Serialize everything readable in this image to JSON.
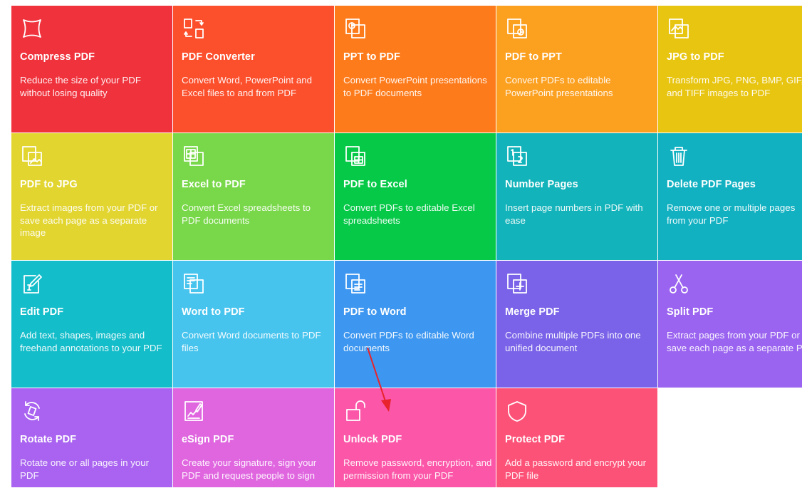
{
  "tools": [
    {
      "title": "Compress PDF",
      "description": "Reduce the size of your PDF without losing quality",
      "color": "#f0323c",
      "icon": "compress-icon"
    },
    {
      "title": "PDF Converter",
      "description": "Convert Word, PowerPoint and Excel files to and from PDF",
      "color": "#fc4f2c",
      "icon": "convert-icon"
    },
    {
      "title": "PPT to PDF",
      "description": "Convert PowerPoint presentations to PDF documents",
      "color": "#fd7b1b",
      "icon": "ppt-icon"
    },
    {
      "title": "PDF to PPT",
      "description": "Convert PDFs to editable PowerPoint presentations",
      "color": "#fca020",
      "icon": "pdf-to-ppt-icon"
    },
    {
      "title": "JPG to PDF",
      "description": "Transform JPG, PNG, BMP, GIF, and TIFF images to PDF",
      "color": "#e8c511",
      "icon": "image-icon"
    },
    {
      "title": "PDF to JPG",
      "description": "Extract images from your PDF or save each page as a separate image",
      "color": "#e2d530",
      "icon": "pdf-to-image-icon"
    },
    {
      "title": "Excel to PDF",
      "description": "Convert Excel spreadsheets to PDF documents",
      "color": "#79d84a",
      "icon": "spreadsheet-icon"
    },
    {
      "title": "PDF to Excel",
      "description": "Convert PDFs to editable Excel spreadsheets",
      "color": "#05c947",
      "icon": "pdf-to-excel-icon"
    },
    {
      "title": "Number Pages",
      "description": "Insert page numbers in PDF with ease",
      "color": "#12b3ba",
      "icon": "number-pages-icon"
    },
    {
      "title": "Delete PDF Pages",
      "description": "Remove one or multiple pages from your PDF",
      "color": "#12b1c2",
      "icon": "trash-icon"
    },
    {
      "title": "Edit PDF",
      "description": "Add text, shapes, images and freehand annotations to your PDF",
      "color": "#14bdca",
      "icon": "edit-icon"
    },
    {
      "title": "Word to PDF",
      "description": "Convert Word documents to PDF files",
      "color": "#47c4ee",
      "icon": "word-icon"
    },
    {
      "title": "PDF to Word",
      "description": "Convert PDFs to editable Word documents",
      "color": "#3d97f0",
      "icon": "pdf-to-word-icon"
    },
    {
      "title": "Merge PDF",
      "description": "Combine multiple PDFs into one unified document",
      "color": "#7a63e8",
      "icon": "merge-icon"
    },
    {
      "title": "Split PDF",
      "description": "Extract pages from your PDF or save each page as a separate PDF",
      "color": "#9b64f0",
      "icon": "scissors-icon"
    },
    {
      "title": "Rotate PDF",
      "description": "Rotate one or all pages in your PDF",
      "color": "#a963f0",
      "icon": "rotate-icon"
    },
    {
      "title": "eSign PDF",
      "description": "Create your signature, sign your PDF and request people to sign",
      "color": "#e066e0",
      "icon": "signature-icon"
    },
    {
      "title": "Unlock PDF",
      "description": "Remove password, encryption, and permission from your PDF",
      "color": "#fb56a8",
      "icon": "unlock-icon"
    },
    {
      "title": "Protect PDF",
      "description": "Add a password and encrypt your PDF file",
      "color": "#fd5277",
      "icon": "shield-icon"
    }
  ],
  "annotation": {
    "type": "arrow",
    "color": "#e8232b"
  }
}
